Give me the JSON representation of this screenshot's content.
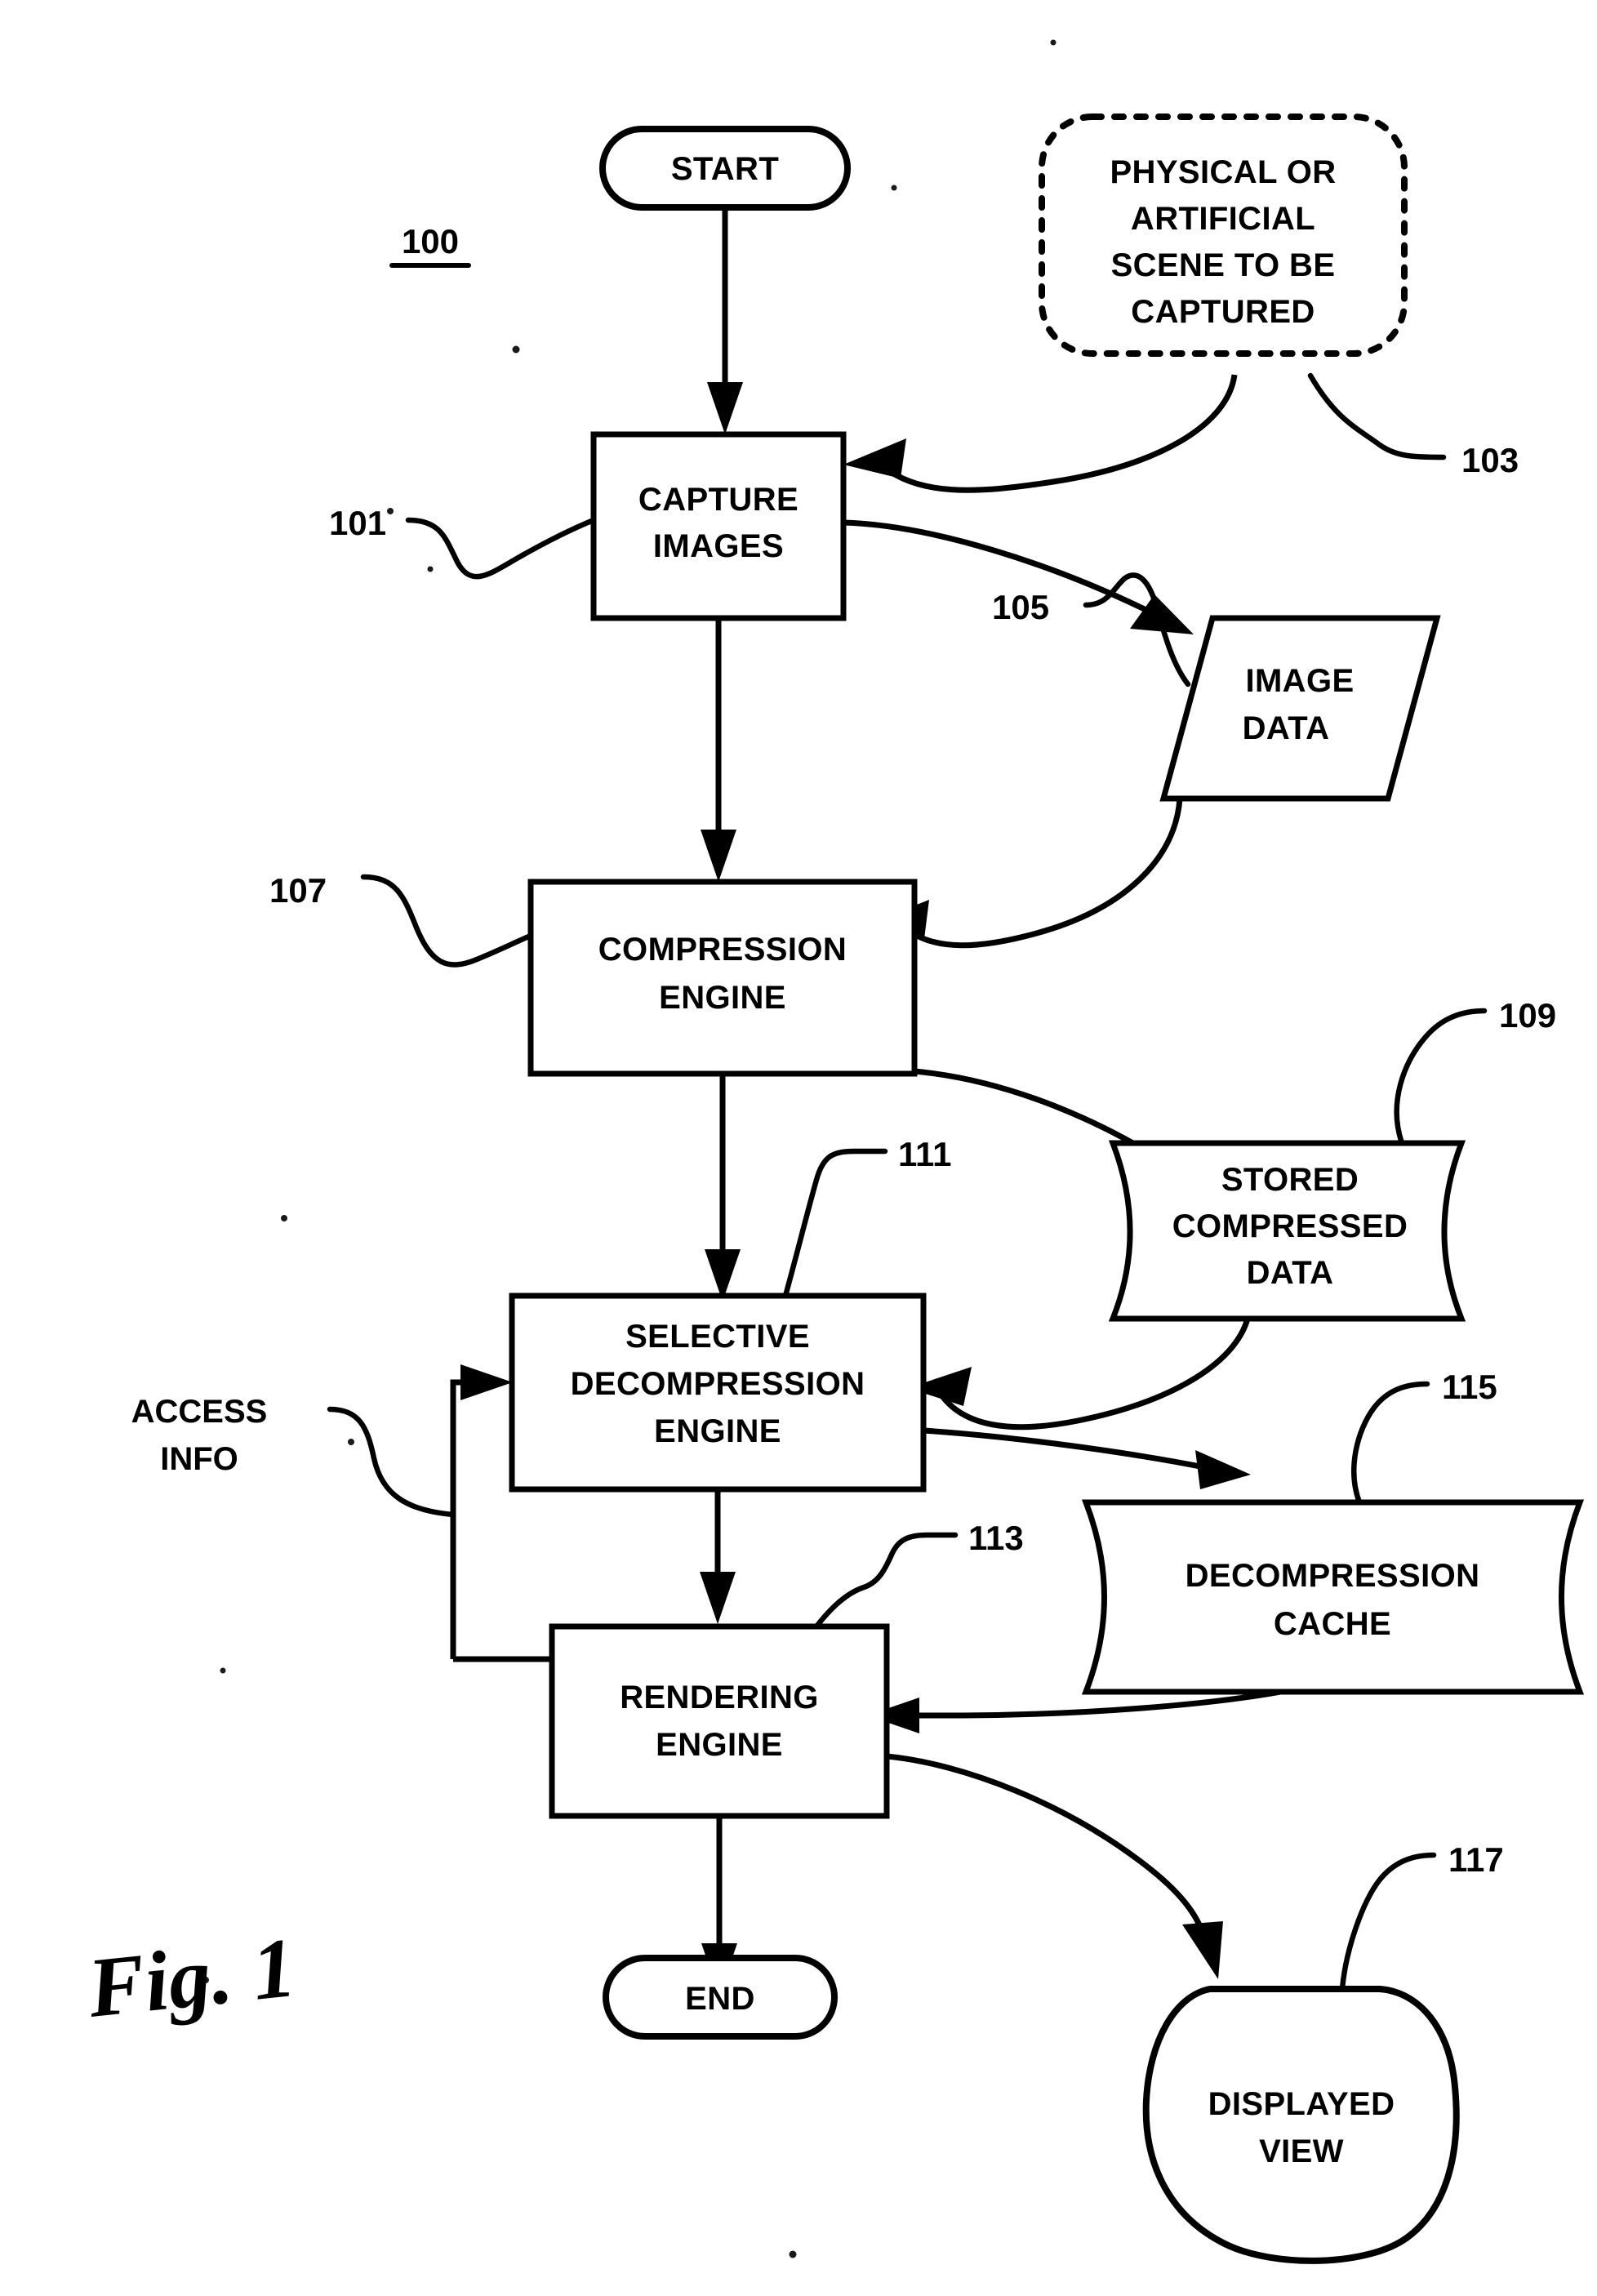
{
  "figure": {
    "caption": "Fig. 1",
    "system_ref": "100"
  },
  "nodes": {
    "start": {
      "label": "START",
      "shape": "stadium"
    },
    "scene": {
      "lines": [
        "PHYSICAL OR",
        "ARTIFICIAL",
        "SCENE TO BE",
        "CAPTURED"
      ],
      "ref": "103",
      "shape": "dashed-rounded"
    },
    "capture": {
      "lines": [
        "CAPTURE",
        "IMAGES"
      ],
      "ref": "101",
      "shape": "rect"
    },
    "image_data": {
      "lines": [
        "IMAGE",
        "DATA"
      ],
      "ref": "105",
      "shape": "parallelogram"
    },
    "compression": {
      "lines": [
        "COMPRESSION",
        "ENGINE"
      ],
      "ref": "107",
      "shape": "rect"
    },
    "stored": {
      "lines": [
        "STORED",
        "COMPRESSED",
        "DATA"
      ],
      "ref": "109",
      "shape": "document"
    },
    "selective": {
      "lines": [
        "SELECTIVE",
        "DECOMPRESSION",
        "ENGINE"
      ],
      "ref": "111",
      "shape": "rect"
    },
    "cache": {
      "lines": [
        "DECOMPRESSION",
        "CACHE"
      ],
      "ref": "115",
      "shape": "document"
    },
    "rendering": {
      "lines": [
        "RENDERING",
        "ENGINE"
      ],
      "ref": "113",
      "shape": "rect"
    },
    "displayed": {
      "lines": [
        "DISPLAYED",
        "VIEW"
      ],
      "ref": "117",
      "shape": "blob"
    },
    "end": {
      "label": "END",
      "shape": "stadium"
    },
    "access_info": {
      "lines": [
        "ACCESS",
        "INFO"
      ],
      "shape": "text-only"
    }
  },
  "colors": {
    "ink": "#000000",
    "paper": "#ffffff"
  }
}
